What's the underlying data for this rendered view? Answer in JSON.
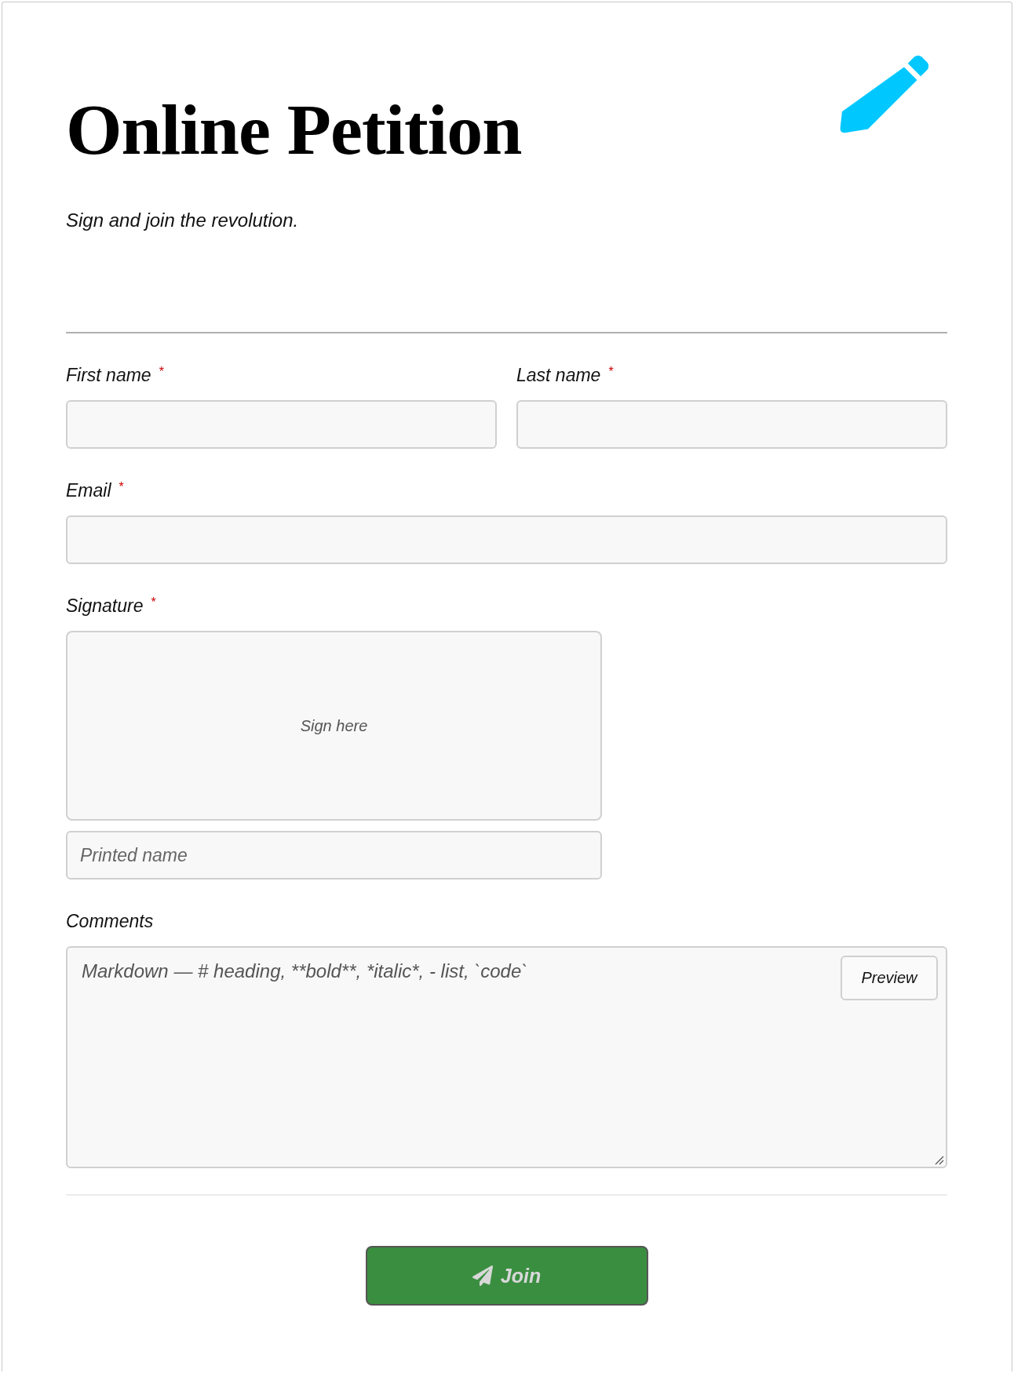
{
  "header": {
    "title": "Online Petition",
    "subtitle": "Sign and join the revolution."
  },
  "required_mark": "*",
  "rows": [
    {
      "fields": [
        {
          "kind": "text",
          "label": "First name",
          "required": true
        },
        {
          "kind": "text",
          "label": "Last name",
          "required": true
        }
      ]
    },
    {
      "fields": [
        {
          "kind": "text",
          "label": "Email",
          "required": true
        }
      ]
    },
    {
      "fields": [
        {
          "kind": "signature",
          "label": "Signature",
          "required": true,
          "pad_text": "Sign here",
          "placeholder": "Printed name"
        }
      ]
    },
    {
      "fields": [
        {
          "kind": "markdown",
          "label": "Comments",
          "required": false,
          "placeholder": "Markdown — # heading, **bold**, *italic*, - list, `code`",
          "preview_button": "Preview"
        }
      ]
    }
  ],
  "submit": {
    "label": "Join"
  }
}
